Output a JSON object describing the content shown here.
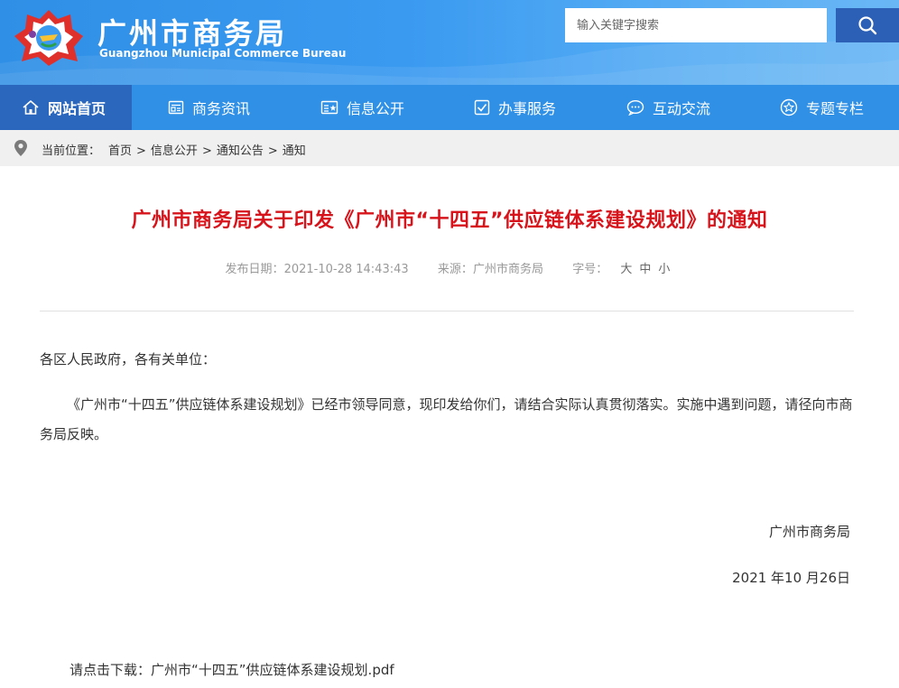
{
  "header": {
    "brand_cn": "广州市商务局",
    "brand_en": "Guangzhou Municipal Commerce Bureau",
    "search_placeholder": "输入关键字搜索"
  },
  "nav": {
    "items": [
      {
        "label": "网站首页",
        "icon": "home-icon",
        "active": true
      },
      {
        "label": "商务资讯",
        "icon": "news-icon"
      },
      {
        "label": "信息公开",
        "icon": "info-card-icon"
      },
      {
        "label": "办事服务",
        "icon": "checkbox-icon"
      },
      {
        "label": "互动交流",
        "icon": "chat-bubble-icon"
      },
      {
        "label": "专题专栏",
        "icon": "star-icon"
      }
    ]
  },
  "breadcrumb": {
    "label": "当前位置：",
    "path": [
      "首页",
      "信息公开",
      "通知公告",
      "通知"
    ],
    "separator": ">"
  },
  "article": {
    "title": "广州市商务局关于印发《广州市“十四五”供应链体系建设规划》的通知",
    "date_label": "发布日期：",
    "date": "2021-10-28 14:43:43",
    "source_label": "来源：",
    "source": "广州市商务局",
    "font_label": "字号：",
    "font_sizes": [
      "大",
      "中",
      "小"
    ],
    "salutation": "各区人民政府，各有关单位：",
    "paragraph": "《广州市“十四五”供应链体系建设规划》已经市领导同意，现印发给你们，请结合实际认真贯彻落实。实施中遇到问题，请径向市商务局反映。",
    "signature": "广州市商务局",
    "sign_date": "2021 年10 月26日",
    "download_label": "请点击下载：",
    "download_file": "广州市“十四五”供应链体系建设规划.pdf"
  },
  "colors": {
    "header_blue": "#2f8fe6",
    "nav_active": "#2b67bd",
    "search_button": "#2c5fb6",
    "title_red": "#d7141b"
  }
}
